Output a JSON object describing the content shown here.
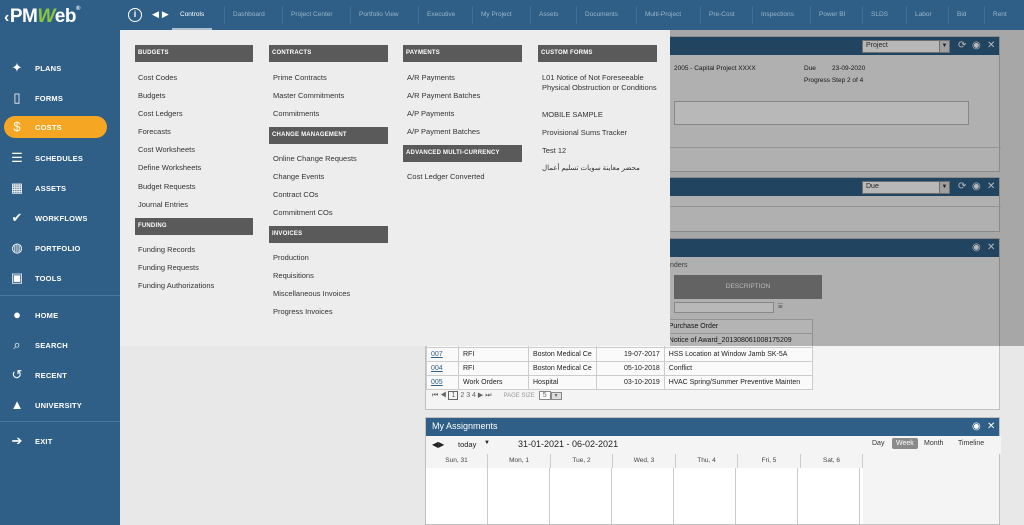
{
  "app": {
    "logo": "PMWeb",
    "logo_pm": "PM",
    "logo_w": "W",
    "logo_eb": "eb",
    "reg": "®"
  },
  "sidebar": {
    "items": [
      {
        "label": "PLANS",
        "icon": "lightbulb-icon",
        "glyph": "✦"
      },
      {
        "label": "FORMS",
        "icon": "document-icon",
        "glyph": "▯"
      },
      {
        "label": "COSTS",
        "icon": "dollar-icon",
        "glyph": "$"
      },
      {
        "label": "SCHEDULES",
        "icon": "schedule-icon",
        "glyph": "☰"
      },
      {
        "label": "ASSETS",
        "icon": "building-icon",
        "glyph": "▦"
      },
      {
        "label": "WORKFLOWS",
        "icon": "checkmark-icon",
        "glyph": "✔"
      },
      {
        "label": "PORTFOLIO",
        "icon": "globe-icon",
        "glyph": "◍"
      },
      {
        "label": "TOOLS",
        "icon": "toolbox-icon",
        "glyph": "▣"
      },
      {
        "label": "HOME",
        "icon": "home-icon",
        "glyph": "●"
      },
      {
        "label": "SEARCH",
        "icon": "search-icon",
        "glyph": "⌕"
      },
      {
        "label": "RECENT",
        "icon": "history-icon",
        "glyph": "↺"
      },
      {
        "label": "UNIVERSITY",
        "icon": "graduation-cap-icon",
        "glyph": "▲"
      },
      {
        "label": "EXIT",
        "icon": "exit-icon",
        "glyph": "➔"
      }
    ]
  },
  "topbar": {
    "tabs": [
      "Controls",
      "Dashboard",
      "Project Center",
      "Portfolio View",
      "Executive",
      "My Project",
      "Assets",
      "Documents",
      "Multi-Project",
      "Pre-Cost",
      "Inspections",
      "Power BI",
      "SLDS",
      "Labor",
      "Bid",
      "Rent"
    ],
    "active_tab": "Controls"
  },
  "menu": {
    "budgets": {
      "header": "BUDGETS",
      "items": [
        "Cost Codes",
        "Budgets",
        "Cost Ledgers",
        "Forecasts",
        "Cost Worksheets",
        "Define Worksheets",
        "Budget Requests",
        "Journal Entries"
      ]
    },
    "funding": {
      "header": "FUNDING",
      "items": [
        "Funding Records",
        "Funding Requests",
        "Funding Authorizations"
      ]
    },
    "contracts": {
      "header": "CONTRACTS",
      "items": [
        "Prime Contracts",
        "Master Commitments",
        "Commitments"
      ]
    },
    "change_management": {
      "header": "CHANGE MANAGEMENT",
      "items": [
        "Online Change Requests",
        "Change Events",
        "Contract COs",
        "Commitment COs"
      ]
    },
    "invoices": {
      "header": "INVOICES",
      "items": [
        "Production",
        "Requisitions",
        "Miscellaneous Invoices",
        "Progress Invoices"
      ]
    },
    "payments": {
      "header": "PAYMENTS",
      "items": [
        "A/R Payments",
        "A/R Payment Batches",
        "A/P Payments",
        "A/P Payment Batches"
      ]
    },
    "advanced_multi_currency": {
      "header": "ADVANCED MULTI-CURRENCY",
      "items": [
        "Cost Ledger Converted"
      ]
    },
    "custom_forms": {
      "header": "CUSTOM FORMS",
      "items": [
        "L01 Notice of Not Foreseeable Physical Obstruction or Conditions",
        "MOBILE SAMPLE",
        "Provisional Sums Tracker",
        "Test 12",
        "محضر معاينة سويات تسليم أعمال"
      ]
    }
  },
  "bg": {
    "panel1": {
      "select": "Project",
      "line1": "2005 - Capital Project XXXX",
      "due_label": "Due",
      "due_value": "23-09-2020",
      "progress": "Progress Step 2 of 4"
    },
    "panel2": {
      "select": "Due"
    },
    "panel3": {
      "subtab": "nders",
      "col_header": "DESCRIPTION",
      "rows": [
        {
          "id": "",
          "type": "",
          "project": "",
          "date": "",
          "desc": "Purchase Order"
        },
        {
          "id": "",
          "type": "",
          "project": "",
          "date": "",
          "desc": "Notice of Award_201308061008175209"
        },
        {
          "id": "007",
          "type": "RFI",
          "project": "Boston Medical Ce",
          "date": "19-07-2017",
          "desc": "HSS Location at Window Jamb SK-5A"
        },
        {
          "id": "004",
          "type": "RFI",
          "project": "Boston Medical Ce",
          "date": "05-10-2018",
          "desc": "Conflict"
        },
        {
          "id": "005",
          "type": "Work Orders",
          "project": "Hospital",
          "date": "03-10-2019",
          "desc": "HVAC Spring/Summer Preventive Mainten"
        }
      ],
      "pager": {
        "pages": [
          "1",
          "2",
          "3",
          "4"
        ],
        "page_size_label": "PAGE SIZE",
        "page_size": "5"
      }
    },
    "assignments": {
      "title": "My Assignments",
      "today": "today",
      "range": "31-01-2021 - 06-02-2021",
      "views": [
        "Day",
        "Week",
        "Month",
        "Timeline"
      ],
      "active_view": "Week",
      "days": [
        "Sun, 31",
        "Mon, 1",
        "Tue, 2",
        "Wed, 3",
        "Thu, 4",
        "Fri, 5",
        "Sat, 6"
      ]
    }
  },
  "colors": {
    "sidebar": "#2f5f86",
    "accent": "#f5a623",
    "category": "#5a5a5a"
  }
}
